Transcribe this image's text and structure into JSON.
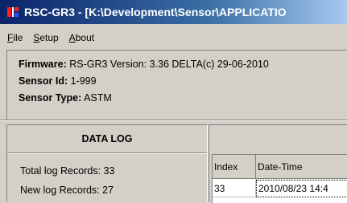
{
  "window": {
    "title": "RSC-GR3 - [K:\\Development\\Sensor\\APPLICATIO"
  },
  "menu": {
    "items": [
      "File",
      "Setup",
      "About"
    ]
  },
  "info": {
    "firmware_label": "Firmware:",
    "firmware_value": "RS-GR3 Version: 3.36 DELTA(c) 29-06-2010",
    "sensor_id_label": "Sensor Id:",
    "sensor_id_value": "1-999",
    "sensor_type_label": "Sensor Type:",
    "sensor_type_value": "ASTM"
  },
  "datalog": {
    "title": "DATA LOG",
    "total_records": "Total log Records: 33",
    "new_records": "New log Records:  27"
  },
  "log_table": {
    "columns": [
      "Index",
      "Date-Time"
    ],
    "rows": [
      [
        "33",
        "2010/08/23 14:4"
      ]
    ]
  },
  "colors": {
    "titlebar_start": "#0a246a",
    "titlebar_end": "#a6caf0",
    "face": "#d4d0c8"
  }
}
